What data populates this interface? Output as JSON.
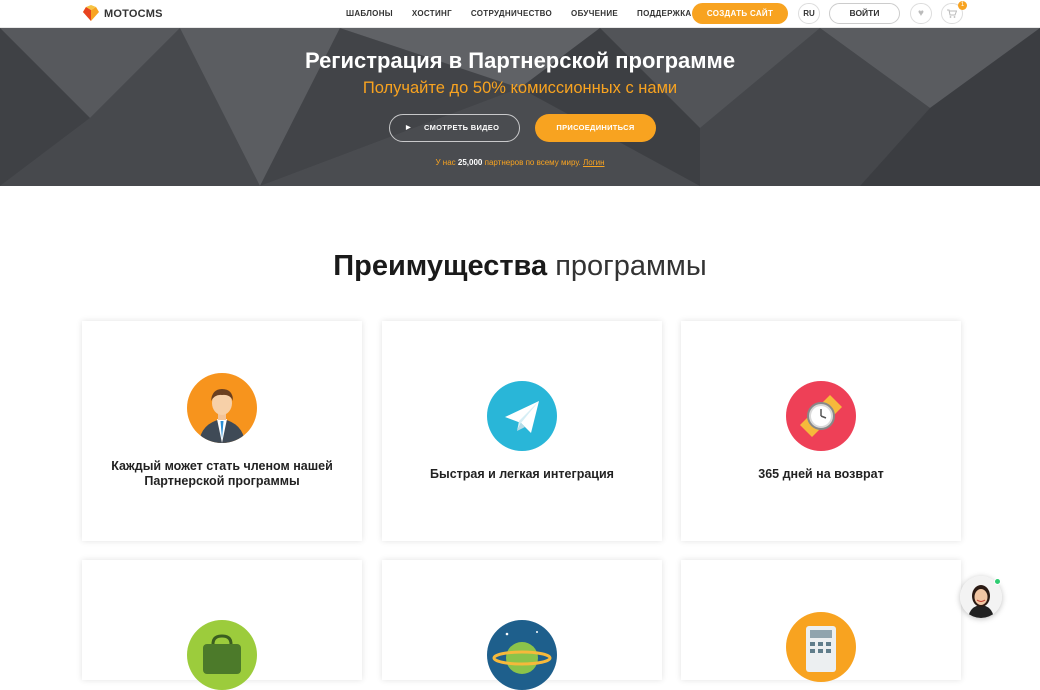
{
  "header": {
    "logo_text": "MOTOCMS",
    "nav": [
      "ШАБЛОНЫ",
      "ХОСТИНГ",
      "СОТРУДНИЧЕСТВО",
      "ОБУЧЕНИЕ",
      "ПОДДЕРЖКА"
    ],
    "create_site": "СОЗДАТЬ САЙТ",
    "lang": "RU",
    "login": "ВОЙТИ",
    "cart_count": "1"
  },
  "hero": {
    "title": "Регистрация в Партнерской программе",
    "subtitle": "Получайте до 50% комиссионных с нами",
    "watch_video": "СМОТРЕТЬ ВИДЕО",
    "join": "ПРИСОЕДИНИТЬСЯ",
    "partners_prefix": "У нас",
    "partners_count": "25,000",
    "partners_suffix": "партнеров по всему миру.",
    "login_link": "Логин"
  },
  "advantages": {
    "title_strong": "Преимущества",
    "title_light": "программы",
    "cards": [
      {
        "text": "Каждый может стать членом нашей Партнерской программы",
        "icon": "person-icon",
        "color": "#f7941d"
      },
      {
        "text": "Быстрая и легкая интеграция",
        "icon": "paper-plane-icon",
        "color": "#29b6d8"
      },
      {
        "text": "365 дней на возврат",
        "icon": "watch-icon",
        "color": "#ee4057"
      },
      {
        "text": "",
        "icon": "wallet-icon",
        "color": "#9ccc3c"
      },
      {
        "text": "",
        "icon": "planet-icon",
        "color": "#1e5f8c"
      },
      {
        "text": "",
        "icon": "calculator-icon",
        "color": "#f8a320"
      }
    ]
  },
  "colors": {
    "accent": "#f8a320",
    "hero_bg": "#4a4c50"
  }
}
